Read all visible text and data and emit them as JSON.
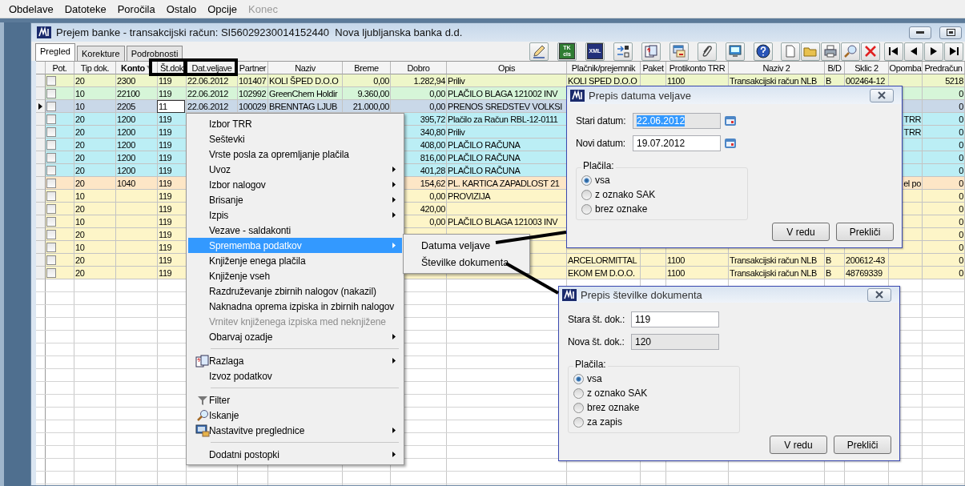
{
  "menu_bar": [
    {
      "label": "Obdelave",
      "disabled": false
    },
    {
      "label": "Datoteke",
      "disabled": false
    },
    {
      "label": "Poročila",
      "disabled": false
    },
    {
      "label": "Ostalo",
      "disabled": false
    },
    {
      "label": "Opcije",
      "disabled": false
    },
    {
      "label": "Konec",
      "disabled": true
    }
  ],
  "window": {
    "title": "Prejem banke - transakcijski račun: SI56029230014152440  Nova ljubljanska banka d.d."
  },
  "tabs": [
    {
      "label": "Pregled",
      "selected": true
    },
    {
      "label": "Korekture",
      "selected": false
    },
    {
      "label": "Podrobnosti",
      "selected": false
    }
  ],
  "toolbar_badges": [
    {
      "lines": [
        "TK",
        "cis"
      ]
    },
    {
      "lines": [
        "XML"
      ]
    }
  ],
  "table": {
    "check_column": "Pot.",
    "columns": [
      {
        "label": "Tip dok.",
        "sorted": false
      },
      {
        "label": "Konto",
        "sorted": true
      },
      {
        "label": "Št.dok",
        "sorted": false
      },
      {
        "label": "Dat.veljave",
        "sorted": false
      },
      {
        "label": "Partner",
        "sorted": false
      },
      {
        "label": "Naziv",
        "sorted": false
      },
      {
        "label": "Breme",
        "sorted": false
      },
      {
        "label": "Dobro",
        "sorted": false
      },
      {
        "label": "Opis",
        "sorted": false
      },
      {
        "label": "Plačnik/prejemnik",
        "sorted": false
      },
      {
        "label": "Paket",
        "sorted": false
      },
      {
        "label": "Protikonto TRR",
        "sorted": false
      },
      {
        "label": "Naziv 2",
        "sorted": false
      },
      {
        "label": "B/D",
        "sorted": false
      },
      {
        "label": "Sklic 2",
        "sorted": false
      },
      {
        "label": "Opomba",
        "sorted": false
      },
      {
        "label": "Predračun",
        "sorted": false
      }
    ],
    "rows": [
      {
        "selected": false,
        "editing": false,
        "checked": false,
        "color": "#eef6c9",
        "cells": [
          "20",
          "2300",
          "119",
          "22.06.2012",
          "101407",
          "KOLI ŠPED D.O.O",
          "0,00",
          "1.282,94",
          "Priliv",
          "KOLI SPED D.O.O",
          null,
          "1100",
          "Transakcijski račun NLB",
          "B",
          "002464-12",
          null,
          "5218"
        ]
      },
      {
        "selected": false,
        "editing": false,
        "checked": false,
        "color": "#d6f5d8",
        "cells": [
          "10",
          "22100",
          "119",
          "22.06.2012",
          "102992",
          "GreenChem Holdir",
          "9.360,00",
          "0,00",
          "PLAČILO BLAGA 121002 INV",
          null,
          null,
          null,
          null,
          null,
          null,
          null,
          "0"
        ]
      },
      {
        "selected": true,
        "editing": true,
        "checked": false,
        "color": "#c9d8e8",
        "cells": [
          "10",
          "2205",
          "11",
          "22.06.2012",
          "100029",
          "BRENNTAG LJUB",
          "21.000,00",
          "0,00",
          "PRENOS SREDSTEV VOLKSI",
          null,
          null,
          null,
          null,
          null,
          null,
          null,
          "0"
        ]
      },
      {
        "selected": false,
        "editing": false,
        "checked": false,
        "color": "#bbeef5",
        "cells": [
          "20",
          "1200",
          "119",
          null,
          null,
          null,
          null,
          "395,72",
          "Plačilo za Račun RBL-12-0111",
          null,
          null,
          null,
          null,
          null,
          null,
          "TRR",
          "0"
        ]
      },
      {
        "selected": false,
        "editing": false,
        "checked": false,
        "color": "#bbeef5",
        "cells": [
          "20",
          "1200",
          "119",
          null,
          null,
          null,
          null,
          "340,80",
          "Priliv",
          null,
          null,
          null,
          null,
          null,
          null,
          "TRR",
          "0"
        ]
      },
      {
        "selected": false,
        "editing": false,
        "checked": false,
        "color": "#bbeef5",
        "cells": [
          "20",
          "1200",
          "119",
          null,
          null,
          null,
          null,
          "408,00",
          "PLAČILO RAČUNA",
          null,
          null,
          null,
          null,
          null,
          null,
          null,
          "0"
        ]
      },
      {
        "selected": false,
        "editing": false,
        "checked": false,
        "color": "#bbeef5",
        "cells": [
          "20",
          "1200",
          "119",
          null,
          null,
          null,
          null,
          "816,00",
          "PLAČILO RAČUNA",
          null,
          null,
          null,
          null,
          null,
          null,
          null,
          "0"
        ]
      },
      {
        "selected": false,
        "editing": false,
        "checked": false,
        "color": "#bbeef5",
        "cells": [
          "20",
          "1200",
          "119",
          null,
          null,
          null,
          null,
          "401,28",
          "PLAČILO RAČUNA",
          null,
          null,
          null,
          null,
          null,
          null,
          null,
          "0"
        ]
      },
      {
        "selected": false,
        "editing": false,
        "checked": false,
        "color": "#fde6c6",
        "cells": [
          "20",
          "1040",
          "119",
          null,
          null,
          null,
          null,
          "154,62",
          "PL. KARTICA ZAPADLOST 21",
          null,
          null,
          null,
          null,
          null,
          null,
          "el po",
          "0"
        ]
      },
      {
        "selected": false,
        "editing": false,
        "checked": false,
        "color": "#fdf5c8",
        "cells": [
          "10",
          null,
          "119",
          null,
          null,
          null,
          null,
          "0,00",
          "PROVIZIJA",
          null,
          null,
          null,
          null,
          null,
          null,
          null,
          "0"
        ]
      },
      {
        "selected": false,
        "editing": false,
        "checked": false,
        "color": "#fdf5c8",
        "cells": [
          "20",
          null,
          "119",
          null,
          null,
          null,
          null,
          "420,00",
          null,
          null,
          null,
          null,
          null,
          null,
          null,
          null,
          "0"
        ]
      },
      {
        "selected": false,
        "editing": false,
        "checked": false,
        "color": "#fdf5c8",
        "cells": [
          "10",
          null,
          "119",
          null,
          null,
          null,
          null,
          "0,00",
          "PLAČILO BLAGA 121003 INV",
          null,
          null,
          null,
          null,
          null,
          null,
          null,
          "0"
        ]
      },
      {
        "selected": false,
        "editing": false,
        "checked": false,
        "color": "#fdf5c8",
        "cells": [
          "20",
          null,
          "119",
          null,
          null,
          null,
          null,
          null,
          null,
          null,
          null,
          null,
          null,
          null,
          null,
          null,
          "0"
        ]
      },
      {
        "selected": false,
        "editing": false,
        "checked": false,
        "color": "#fdf5c8",
        "cells": [
          "10",
          null,
          "119",
          null,
          null,
          null,
          null,
          null,
          null,
          null,
          null,
          null,
          null,
          null,
          null,
          null,
          "0"
        ]
      },
      {
        "selected": false,
        "editing": false,
        "checked": false,
        "color": "#fdf5c8",
        "cells": [
          "20",
          null,
          "119",
          null,
          null,
          null,
          null,
          null,
          null,
          "ARCELORMITTAL",
          null,
          "1100",
          "Transakcijski račun NLB",
          "B",
          "200612-43",
          null,
          "0"
        ]
      },
      {
        "selected": false,
        "editing": false,
        "checked": false,
        "color": "#fdf5c8",
        "cells": [
          "20",
          null,
          "119",
          null,
          null,
          null,
          null,
          null,
          null,
          "EKOM EM D.O.O.",
          null,
          "1100",
          "Transakcijski račun NLB",
          "B",
          "48769339",
          null,
          "0"
        ]
      }
    ]
  },
  "context_menu": {
    "items": [
      {
        "kind": "item",
        "label": "Izbor TRR",
        "submenu": false,
        "disabled": false,
        "selected": false
      },
      {
        "kind": "item",
        "label": "Seštevki",
        "submenu": false,
        "disabled": false,
        "selected": false
      },
      {
        "kind": "item",
        "label": "Vrste posla za opremljanje plačila",
        "submenu": false,
        "disabled": false,
        "selected": false
      },
      {
        "kind": "item",
        "label": "Uvoz",
        "submenu": true,
        "disabled": false,
        "selected": false
      },
      {
        "kind": "item",
        "label": "Izbor nalogov",
        "submenu": true,
        "disabled": false,
        "selected": false
      },
      {
        "kind": "item",
        "label": "Brisanje",
        "submenu": true,
        "disabled": false,
        "selected": false
      },
      {
        "kind": "item",
        "label": "Izpis",
        "submenu": true,
        "disabled": false,
        "selected": false
      },
      {
        "kind": "item",
        "label": "Vezave - saldakonti",
        "submenu": false,
        "disabled": false,
        "selected": false
      },
      {
        "kind": "item",
        "label": "Sprememba podatkov",
        "submenu": true,
        "disabled": false,
        "selected": true
      },
      {
        "kind": "item",
        "label": "Knjiženje enega plačila",
        "submenu": false,
        "disabled": false,
        "selected": false
      },
      {
        "kind": "item",
        "label": "Knjiženje vseh",
        "submenu": false,
        "disabled": false,
        "selected": false
      },
      {
        "kind": "item",
        "label": "Razdruževanje zbirnih nalogov (nakazil)",
        "submenu": false,
        "disabled": false,
        "selected": false
      },
      {
        "kind": "item",
        "label": "Naknadna oprema izpiska in zbirnih nalogov",
        "submenu": false,
        "disabled": false,
        "selected": false
      },
      {
        "kind": "item",
        "label": "Vrnitev knjiženega izpiska med neknjižene",
        "submenu": false,
        "disabled": true,
        "selected": false
      },
      {
        "kind": "item",
        "label": "Obarvaj ozadje",
        "submenu": true,
        "disabled": false,
        "selected": false
      },
      {
        "kind": "separator"
      },
      {
        "kind": "explain",
        "label": "Razlaga",
        "submenu": true,
        "disabled": false,
        "selected": false
      },
      {
        "kind": "item",
        "label": "Izvoz podatkov",
        "submenu": false,
        "disabled": false,
        "selected": false
      },
      {
        "kind": "separator"
      },
      {
        "kind": "filter",
        "label": "Filter",
        "submenu": false,
        "disabled": false,
        "selected": false
      },
      {
        "kind": "search",
        "label": "Iskanje",
        "submenu": false,
        "disabled": false,
        "selected": false
      },
      {
        "kind": "setup",
        "label": "Nastavitve preglednice",
        "submenu": true,
        "disabled": false,
        "selected": false
      },
      {
        "kind": "separator"
      },
      {
        "kind": "item",
        "label": "Dodatni postopki",
        "submenu": true,
        "disabled": false,
        "selected": false
      }
    ],
    "submenu": [
      "Datuma veljave",
      "Številke dokumenta"
    ]
  },
  "date_dialog": {
    "title": "Prepis datuma veljave",
    "fields": [
      {
        "label": "Stari datum:",
        "value": "22.06.2012",
        "disabled": true,
        "highlighted": true
      },
      {
        "label": "Novi datum:",
        "value": "19.07.2012",
        "disabled": false,
        "highlighted": false
      }
    ],
    "group": "Plačila:",
    "options": [
      {
        "label": "vsa",
        "selected": true
      },
      {
        "label": "z oznako SAK",
        "selected": false
      },
      {
        "label": "brez oznake",
        "selected": false
      }
    ],
    "buttons": [
      "V redu",
      "Prekliči"
    ]
  },
  "number_dialog": {
    "title": "Prepis številke dokumenta",
    "fields": [
      {
        "label": "Stara št. dok.:",
        "value": "119",
        "disabled": false,
        "highlighted": false
      },
      {
        "label": "Nova št. dok.:",
        "value": "120",
        "disabled": true,
        "highlighted": false
      }
    ],
    "group": "Plačila:",
    "options": [
      {
        "label": "vsa",
        "selected": true
      },
      {
        "label": "z oznako SAK",
        "selected": false
      },
      {
        "label": "brez oznake",
        "selected": false
      },
      {
        "label": "za zapis",
        "selected": false
      }
    ],
    "buttons": [
      "V redu",
      "Prekliči"
    ]
  }
}
